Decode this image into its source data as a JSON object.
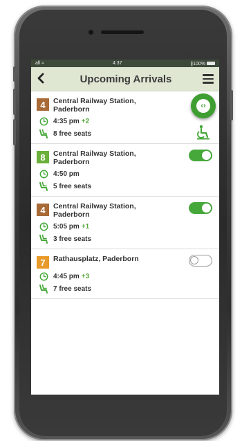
{
  "status": {
    "signal": "all ≈",
    "time": "4:37",
    "battery": "∦100%"
  },
  "header": {
    "title": "Upcoming Arrivals"
  },
  "colors": {
    "brown": "#a86a37",
    "green": "#6bb03a",
    "orange": "#e89a2a",
    "accent": "#46a83a",
    "delay": "#5aaa3c"
  },
  "arrivals": [
    {
      "line": "4",
      "color": "#a86a37",
      "stop": "Central Railway Station, Paderborn",
      "time": "4:35 pm",
      "delay": "+2",
      "seats": "8 free seats",
      "toggle": "fab"
    },
    {
      "line": "8",
      "color": "#6bb03a",
      "stop": "Central Railway Station, Paderborn",
      "time": "4:50 pm",
      "delay": "",
      "seats": "5 free seats",
      "toggle": "on"
    },
    {
      "line": "4",
      "color": "#a86a37",
      "stop": "Central Railway Station, Paderborn",
      "time": "5:05 pm",
      "delay": "+1",
      "seats": "3 free seats",
      "toggle": "on"
    },
    {
      "line": "7",
      "color": "#e89a2a",
      "stop": "Rathausplatz, Paderborn",
      "time": "4:45 pm",
      "delay": "+3",
      "seats": "7 free seats",
      "toggle": "off"
    }
  ],
  "fab": {
    "icon": "code-arrows-icon"
  },
  "icons": [
    "back-chevron-icon",
    "menu-icon",
    "clock-icon",
    "seat-icon",
    "wheelchair-icon"
  ]
}
